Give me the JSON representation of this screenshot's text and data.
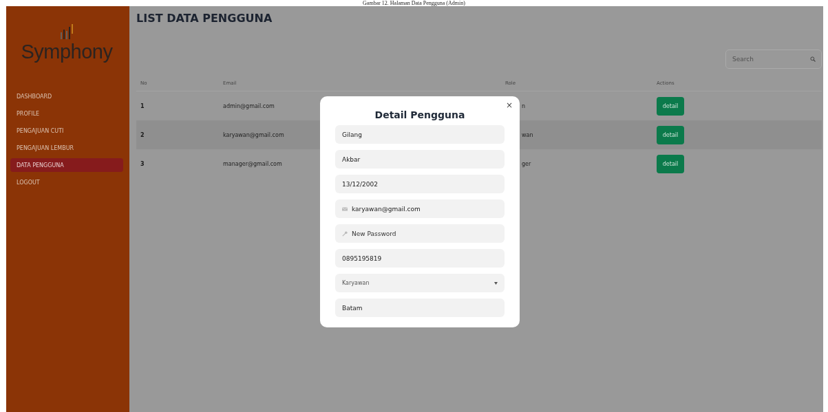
{
  "caption": "Gambar 12. Halaman Data Pengguna (Admin)",
  "sidebar": {
    "logo_text": "Symphony",
    "items": [
      {
        "label": "DASHBOARD",
        "selected": false
      },
      {
        "label": "PROFILE",
        "selected": false
      },
      {
        "label": "PENGAJUAN CUTI",
        "selected": false
      },
      {
        "label": "PENGAJUAN LEMBUR",
        "selected": false
      },
      {
        "label": "DATA PENGGUNA",
        "selected": true
      },
      {
        "label": "LOGOUT",
        "selected": false
      }
    ]
  },
  "page_title": "LIST DATA PENGGUNA",
  "search": {
    "placeholder": "Search"
  },
  "table": {
    "columns": [
      "No",
      "Email",
      "Role",
      "Actions"
    ],
    "rows": [
      {
        "no": "1",
        "email": "admin@gmail.com",
        "role": "n",
        "action": "detail"
      },
      {
        "no": "2",
        "email": "karyawan@gmail.com",
        "role": "wan",
        "action": "detail"
      },
      {
        "no": "3",
        "email": "manager@gmail.com",
        "role": "ger",
        "action": "detail"
      }
    ]
  },
  "modal": {
    "title": "Detail Pengguna",
    "close": "×",
    "fields": [
      {
        "kind": "text",
        "value": "Gilang"
      },
      {
        "kind": "text",
        "value": "Akbar"
      },
      {
        "kind": "text",
        "value": "13/12/2002"
      },
      {
        "kind": "email",
        "value": "karyawan@gmail.com"
      },
      {
        "kind": "password",
        "placeholder": "New Password"
      },
      {
        "kind": "text",
        "value": "0895195819"
      },
      {
        "kind": "select",
        "value": "Karyawan"
      },
      {
        "kind": "text",
        "value": "Batam"
      }
    ]
  }
}
